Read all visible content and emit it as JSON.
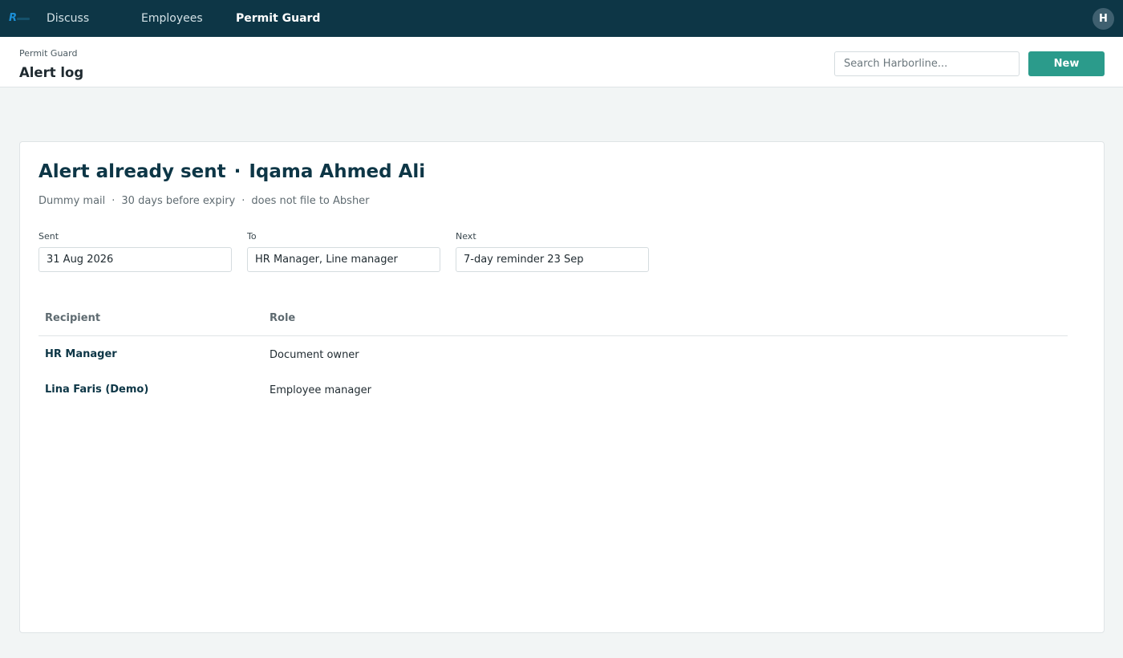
{
  "topbar": {
    "nav": [
      {
        "label": "Discuss"
      },
      {
        "label": "Employees"
      },
      {
        "label": "Permit Guard"
      }
    ],
    "avatar_initial": "H",
    "colors": {
      "bar": "#0d3646",
      "accent": "#2b9b8b"
    }
  },
  "control_panel": {
    "breadcrumb": "Permit Guard",
    "title": "Alert log",
    "search_placeholder": "Search Harborline...",
    "new_label": "New"
  },
  "alert": {
    "status": "Alert already sent",
    "separator": "·",
    "document": "Iqama Ahmed Ali",
    "subtitle": {
      "channel": "Dummy mail",
      "timing": "30 days before expiry",
      "note": "does not file to Absher",
      "dot": "·"
    },
    "fields": {
      "sent": {
        "label": "Sent",
        "value": "31 Aug 2026"
      },
      "to": {
        "label": "To",
        "value": "HR Manager, Line manager"
      },
      "next": {
        "label": "Next",
        "value": "7-day reminder 23 Sep"
      }
    }
  },
  "recipients": {
    "columns": {
      "recipient": "Recipient",
      "role": "Role"
    },
    "rows": [
      {
        "name": "HR Manager",
        "role": "Document owner"
      },
      {
        "name": "Lina Faris (Demo)",
        "role": "Employee manager"
      }
    ]
  }
}
